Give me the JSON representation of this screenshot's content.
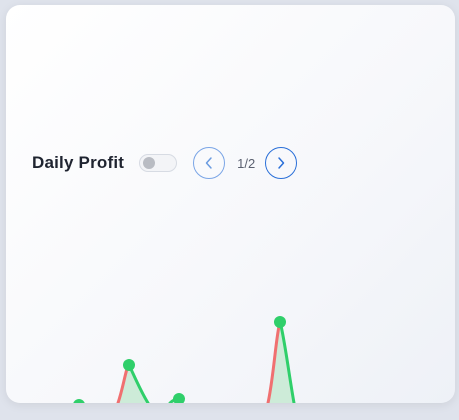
{
  "widget": {
    "title": "Daily Profit",
    "toggle_on": false,
    "pagination": {
      "current": 1,
      "total": 2,
      "text": "1/2"
    },
    "icons": {
      "prev": "chevron-left-icon",
      "next": "chevron-right-icon"
    }
  },
  "colors": {
    "gain": "#2fcf6a",
    "loss": "#f07070",
    "gain_fill": "#cdebd8",
    "accent": "#2a6fd8"
  }
}
